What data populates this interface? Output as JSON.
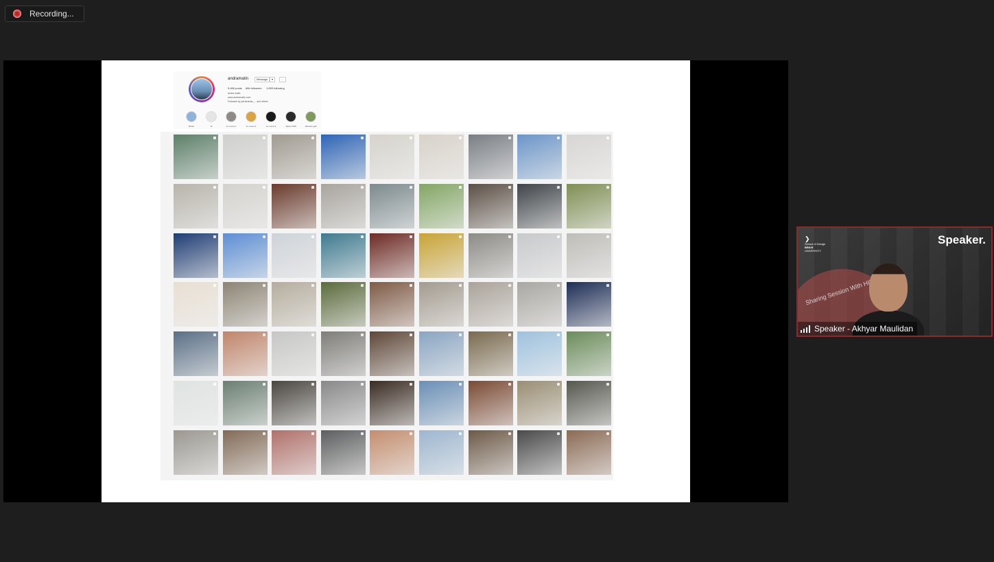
{
  "recording": {
    "label": "Recording...",
    "icon": "record-icon",
    "dot_color": "#d04848"
  },
  "shared_screen": {
    "profile": {
      "username": "andramatin",
      "buttons": [
        "Message",
        "▾",
        "…"
      ],
      "stats": [
        "5,466 posts",
        "86k followers",
        "1,895 following"
      ],
      "bio": [
        "andra matin",
        "www.andramatin.com",
        "Followed by pirriaranda_... and others"
      ],
      "highlights": [
        "Brasil",
        "Jk",
        "A+ Lema 1",
        "A+ Lema 2",
        "A+ Lema 3",
        "Japan 2019",
        "Wooden gall"
      ]
    },
    "grid_columns": 9,
    "grid_rows": 7,
    "thumbnail_colors": [
      [
        "#5d7f69",
        "#cfcfcc",
        "#a09a90",
        "#2e64b6",
        "#d6d3cc",
        "#d8d2c9",
        "#7a7e84",
        "#6b95c8",
        "#d8d6d4"
      ],
      [
        "#b8b4ab",
        "#d4d2ce",
        "#6a3a2c",
        "#a8a49e",
        "#7c8a8e",
        "#83a665",
        "#5b4f45",
        "#3f4448",
        "#7f8f54"
      ],
      [
        "#1f3d74",
        "#5d8ed4",
        "#cfd3d8",
        "#3f7a8f",
        "#6e2a24",
        "#c8a335",
        "#8d8b86",
        "#c8c9cb",
        "#bfbdb9"
      ],
      [
        "#e8dfd3",
        "#8d8474",
        "#b5ad9e",
        "#5c6b3d",
        "#7f5b46",
        "#a39b8f",
        "#aaa39a",
        "#a9a7a2",
        "#1d2d55"
      ],
      [
        "#5a6f85",
        "#c1856b",
        "#c7c7c5",
        "#7e7d79",
        "#5e4738",
        "#8aa5c2",
        "#7a6a4e",
        "#9ec2de",
        "#6b8c5b"
      ],
      [
        "#dfe3e2",
        "#6b7f72",
        "#4a4640",
        "#898989",
        "#3a2c22",
        "#6a8fb6",
        "#7b4a34",
        "#9a8e74",
        "#56584f"
      ],
      [
        "#9b9891",
        "#826b57",
        "#b1716a",
        "#5d5e5f",
        "#c48e6f",
        "#9db6cf",
        "#6d5a48",
        "#4a4a4a",
        "#8b6b55"
      ]
    ]
  },
  "speaker_tile": {
    "brand": "Speaker.",
    "logo_lines": [
      "School of Design",
      "BINUS",
      "UNIVERSITY"
    ],
    "banner_text": "Sharing Session With HIMARS 2021",
    "name_label": "Speaker - Akhyar Maulidan",
    "signal_icon": "signal-strength-icon",
    "border_color": "#8a2b2b"
  }
}
